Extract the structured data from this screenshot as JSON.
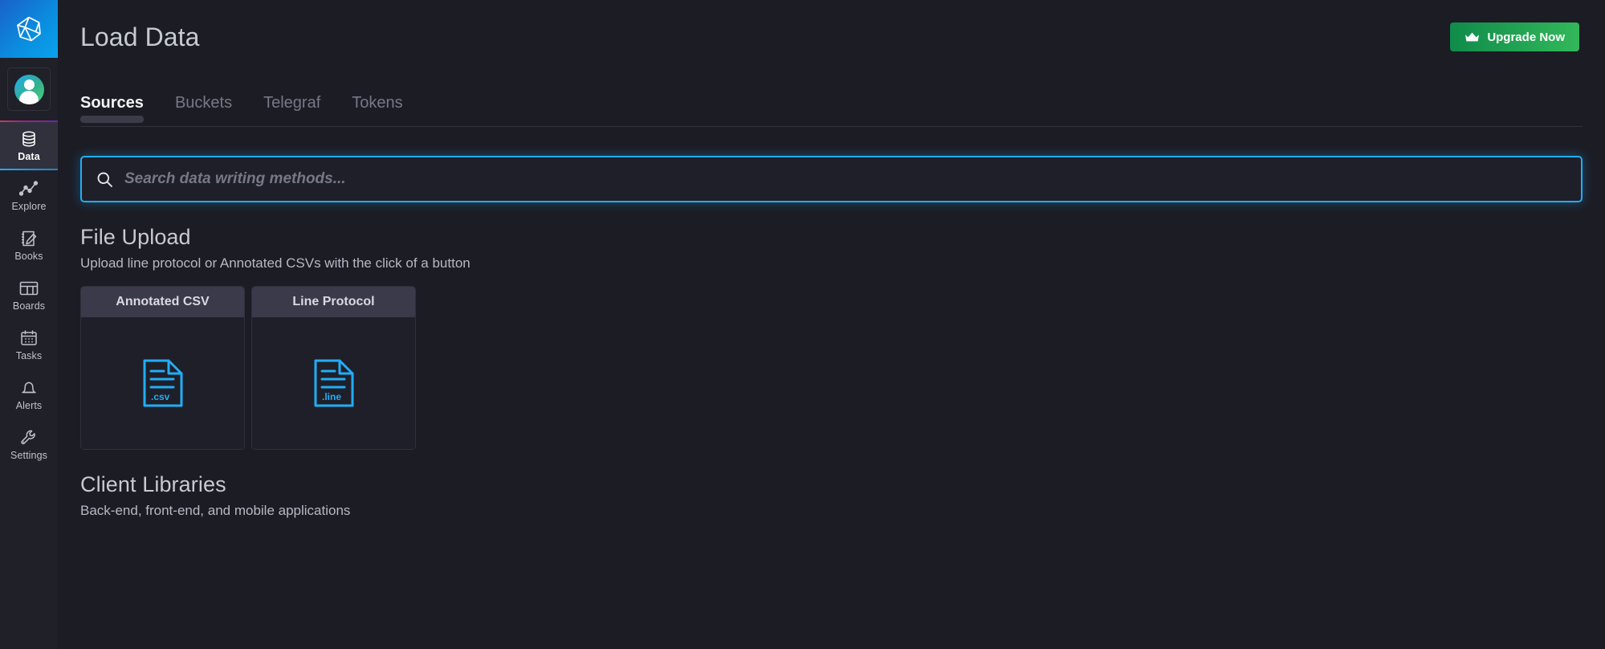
{
  "app": {
    "brand_icon": "influxdb-logo-icon",
    "accent_blue": "#22adf6",
    "accent_green": "#32b85a",
    "sidebar_bg": "#202028",
    "main_bg": "#1c1c24"
  },
  "sidebar": {
    "avatar_icon": "user-avatar-icon",
    "items": [
      {
        "label": "Data",
        "icon": "database-icon",
        "active": true
      },
      {
        "label": "Explore",
        "icon": "graph-line-icon",
        "active": false
      },
      {
        "label": "Books",
        "icon": "notebook-pencil-icon",
        "active": false
      },
      {
        "label": "Boards",
        "icon": "dashboard-grid-icon",
        "active": false
      },
      {
        "label": "Tasks",
        "icon": "calendar-icon",
        "active": false
      },
      {
        "label": "Alerts",
        "icon": "bell-icon",
        "active": false
      },
      {
        "label": "Settings",
        "icon": "wrench-icon",
        "active": false
      }
    ]
  },
  "header": {
    "title": "Load Data",
    "upgrade_label": "Upgrade Now",
    "upgrade_icon": "crown-icon"
  },
  "tabs": [
    {
      "label": "Sources",
      "active": true
    },
    {
      "label": "Buckets",
      "active": false
    },
    {
      "label": "Telegraf",
      "active": false
    },
    {
      "label": "Tokens",
      "active": false
    }
  ],
  "search": {
    "placeholder": "Search data writing methods...",
    "value": "",
    "icon": "search-icon",
    "focused": true
  },
  "file_upload": {
    "title": "File Upload",
    "subtitle": "Upload line protocol or Annotated CSVs with the click of a button",
    "cards": [
      {
        "title": "Annotated CSV",
        "ext": ".csv",
        "icon": "file-csv-icon"
      },
      {
        "title": "Line Protocol",
        "ext": ".line",
        "icon": "file-line-icon"
      }
    ]
  },
  "client_libraries": {
    "title": "Client Libraries",
    "subtitle": "Back-end, front-end, and mobile applications"
  }
}
